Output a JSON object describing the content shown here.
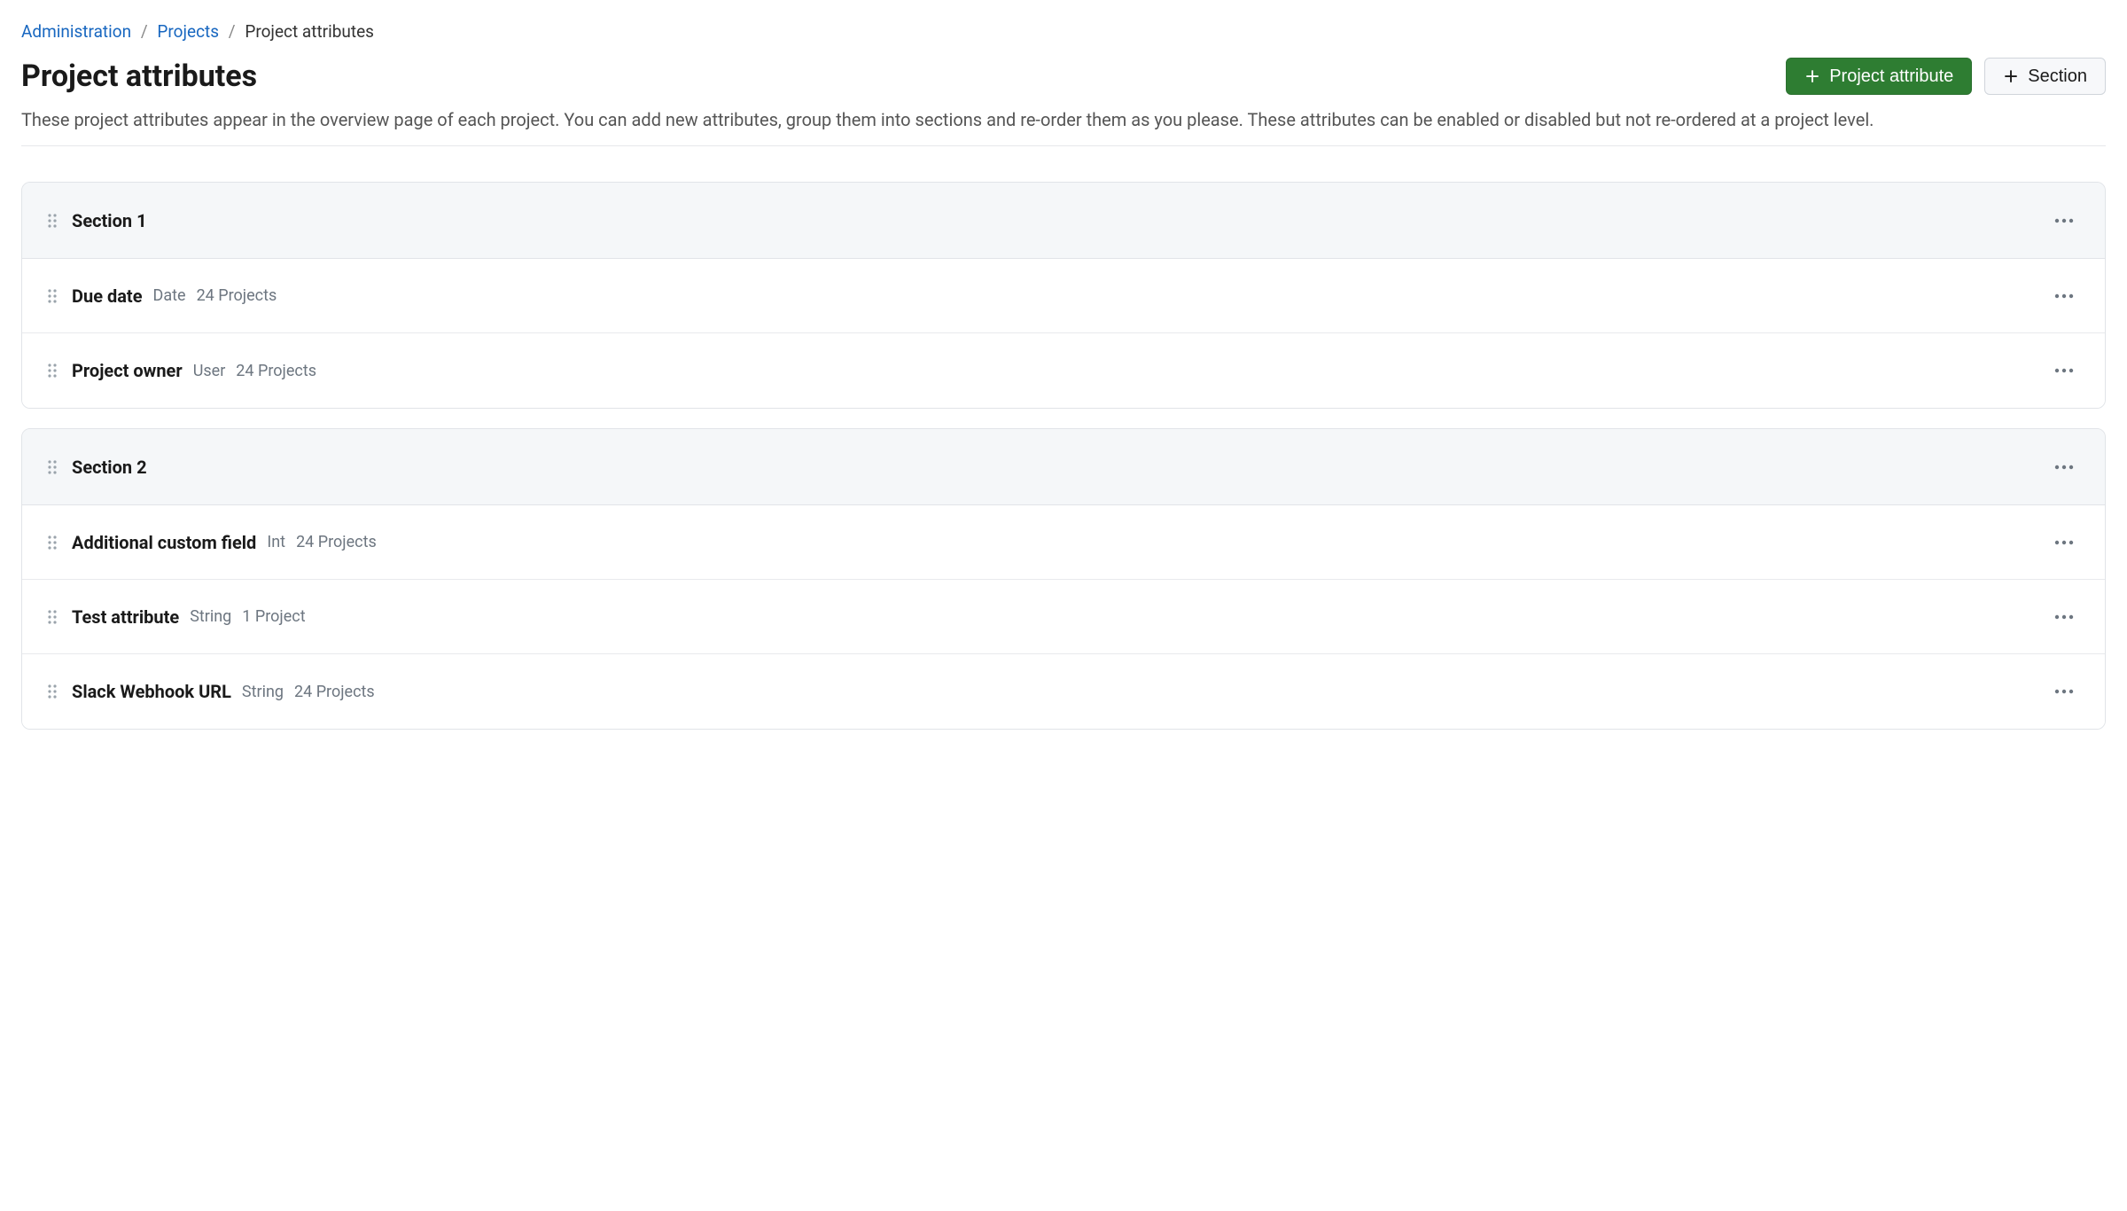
{
  "breadcrumbs": {
    "administration": "Administration",
    "projects": "Projects",
    "current": "Project attributes"
  },
  "page": {
    "title": "Project attributes",
    "description": "These project attributes appear in the overview page of each project. You can add new attributes, group them into sections and re-order them as you please. These attributes can be enabled or disabled but not re-ordered at a project level."
  },
  "buttons": {
    "project_attribute": "Project attribute",
    "section": "Section"
  },
  "sections": [
    {
      "title": "Section 1",
      "attributes": [
        {
          "name": "Due date",
          "type": "Date",
          "projects": "24 Projects"
        },
        {
          "name": "Project owner",
          "type": "User",
          "projects": "24 Projects"
        }
      ]
    },
    {
      "title": "Section 2",
      "attributes": [
        {
          "name": "Additional custom field",
          "type": "Int",
          "projects": "24 Projects"
        },
        {
          "name": "Test attribute",
          "type": "String",
          "projects": "1 Project"
        },
        {
          "name": "Slack Webhook URL",
          "type": "String",
          "projects": "24 Projects"
        }
      ]
    }
  ]
}
